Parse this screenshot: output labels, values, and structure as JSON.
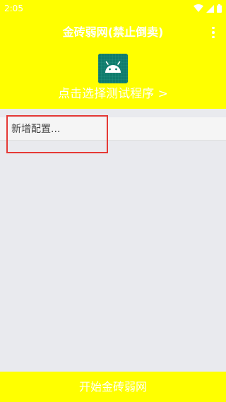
{
  "status_bar": {
    "time": "2:05",
    "icons": [
      "wifi-icon",
      "signal-icon",
      "battery-icon"
    ]
  },
  "header": {
    "title": "金砖弱网(禁止倒卖)",
    "pick_program": "点击选择测试程序 >"
  },
  "config_list": {
    "items": [
      {
        "label": "新增配置..."
      }
    ]
  },
  "bottom_button": {
    "label": "开始金砖弱网"
  },
  "colors": {
    "accent": "#ffff00",
    "text_on_accent": "#ffffff",
    "background": "#e9eaee",
    "highlight": "#e53935",
    "app_icon_bg": "#0f7b6c"
  }
}
